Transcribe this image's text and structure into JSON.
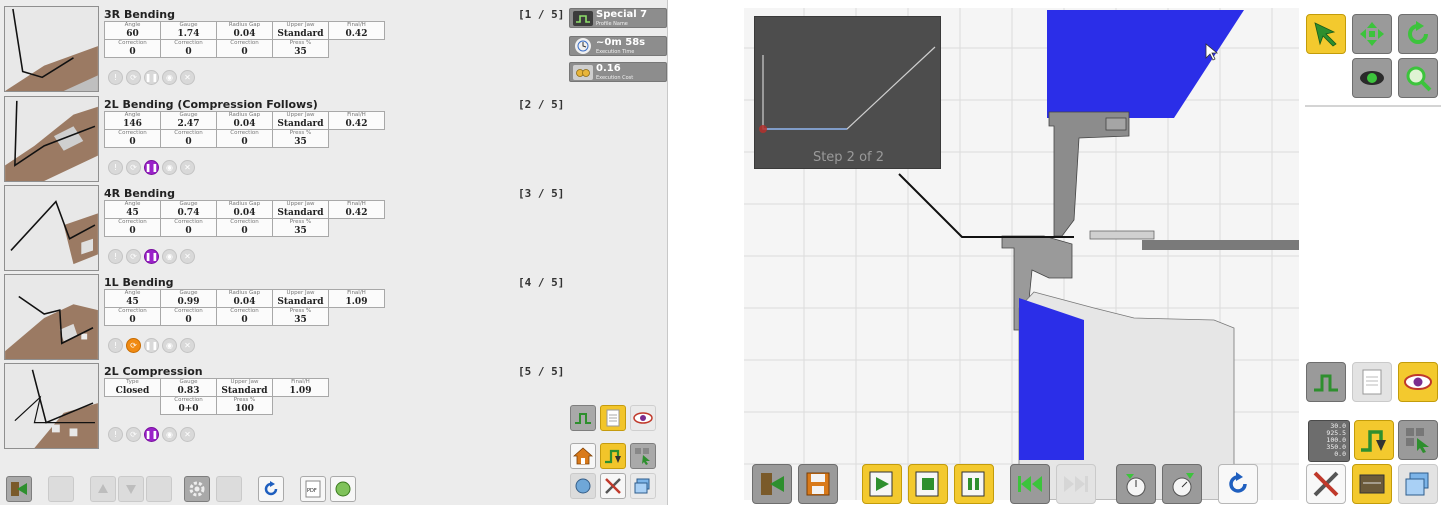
{
  "steps": [
    {
      "title": "3R Bending",
      "index": "[1 / 5]",
      "rows": [
        [
          {
            "label": "Angle",
            "value": "60"
          },
          {
            "label": "Gauge",
            "value": "1.74"
          },
          {
            "label": "Radius Gap",
            "value": "0.04"
          },
          {
            "label": "Upper Jaw",
            "value": "Standard"
          },
          {
            "label": "Final/H",
            "value": "0.42"
          }
        ],
        [
          {
            "label": "Correction",
            "value": "0"
          },
          {
            "label": "Correction",
            "value": "0"
          },
          {
            "label": "Correction",
            "value": "0"
          },
          {
            "label": "Press %",
            "value": "35"
          }
        ]
      ],
      "active_mode": ""
    },
    {
      "title": "2L Bending (Compression Follows)",
      "index": "[2 / 5]",
      "rows": [
        [
          {
            "label": "Angle",
            "value": "146"
          },
          {
            "label": "Gauge",
            "value": "2.47"
          },
          {
            "label": "Radius Gap",
            "value": "0.04"
          },
          {
            "label": "Upper Jaw",
            "value": "Standard"
          },
          {
            "label": "Final/H",
            "value": "0.42"
          }
        ],
        [
          {
            "label": "Correction",
            "value": "0"
          },
          {
            "label": "Correction",
            "value": "0"
          },
          {
            "label": "Correction",
            "value": "0"
          },
          {
            "label": "Press %",
            "value": "35"
          }
        ]
      ],
      "active_mode": "pause"
    },
    {
      "title": "4R Bending",
      "index": "[3 / 5]",
      "rows": [
        [
          {
            "label": "Angle",
            "value": "45"
          },
          {
            "label": "Gauge",
            "value": "0.74"
          },
          {
            "label": "Radius Gap",
            "value": "0.04"
          },
          {
            "label": "Upper Jaw",
            "value": "Standard"
          },
          {
            "label": "Final/H",
            "value": "0.42"
          }
        ],
        [
          {
            "label": "Correction",
            "value": "0"
          },
          {
            "label": "Correction",
            "value": "0"
          },
          {
            "label": "Correction",
            "value": "0"
          },
          {
            "label": "Press %",
            "value": "35"
          }
        ]
      ],
      "active_mode": "pause"
    },
    {
      "title": "1L Bending",
      "index": "[4 / 5]",
      "rows": [
        [
          {
            "label": "Angle",
            "value": "45"
          },
          {
            "label": "Gauge",
            "value": "0.99"
          },
          {
            "label": "Radius Gap",
            "value": "0.04"
          },
          {
            "label": "Upper Jaw",
            "value": "Standard"
          },
          {
            "label": "Final/H",
            "value": "1.09"
          }
        ],
        [
          {
            "label": "Correction",
            "value": "0"
          },
          {
            "label": "Correction",
            "value": "0"
          },
          {
            "label": "Correction",
            "value": "0"
          },
          {
            "label": "Press %",
            "value": "35"
          }
        ]
      ],
      "active_mode": "auto"
    },
    {
      "title": "2L Compression",
      "index": "[5 / 5]",
      "rows": [
        [
          {
            "label": "Type",
            "value": "Closed"
          },
          {
            "label": "Gauge",
            "value": "0.83"
          },
          {
            "label": "Upper Jaw",
            "value": "Standard"
          },
          {
            "label": "Final/H",
            "value": "1.09"
          }
        ],
        [
          {
            "label": "",
            "value": ""
          },
          {
            "label": "Correction",
            "value": "0+0"
          },
          {
            "label": "Press %",
            "value": "100"
          }
        ]
      ],
      "active_mode": "pause"
    }
  ],
  "info": {
    "profile_name": {
      "value": "Special 7",
      "label": "Profile Name",
      "icon": "profile-icon"
    },
    "execution_time": {
      "value": "~0m 58s",
      "label": "Execution Time",
      "icon": "clock-icon"
    },
    "execution_cost": {
      "value": "0.16",
      "label": "Execution Cost",
      "icon": "coins-icon"
    }
  },
  "simulation": {
    "mini_caption": "Step 2 of 2"
  },
  "readout": {
    "lines": [
      "30.0",
      "925.5",
      "100.0",
      "350.0",
      "0.0"
    ]
  },
  "colors": {
    "tool_blue": "#2b2ee8",
    "accent_yellow": "#f2c52a",
    "panel_gray": "#ececec",
    "pause_purple": "#9a22c9",
    "auto_orange": "#f08a12"
  }
}
